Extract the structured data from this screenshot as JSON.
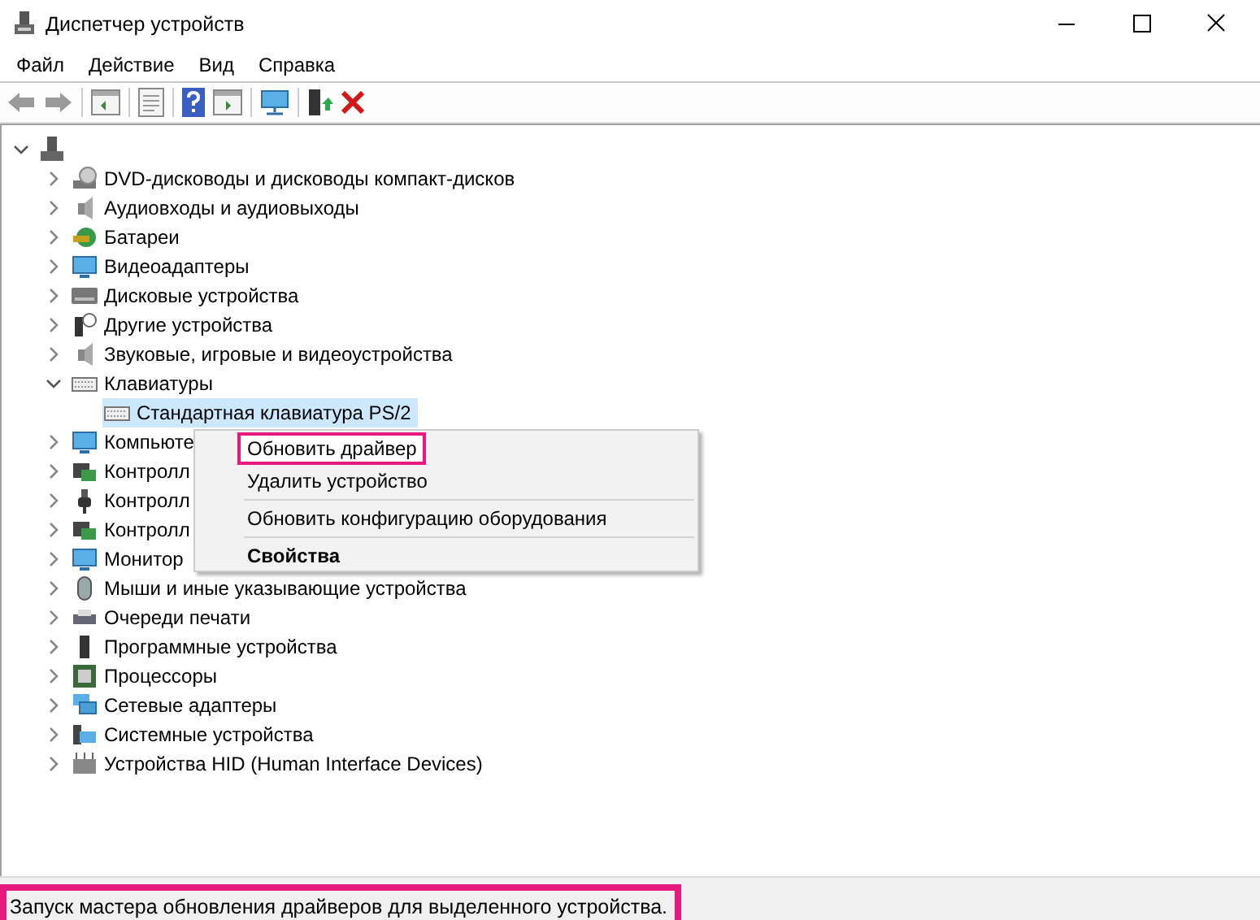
{
  "window": {
    "title": "Диспетчер устройств"
  },
  "menu_bar": [
    "Файл",
    "Действие",
    "Вид",
    "Справка"
  ],
  "tree": {
    "expanded": true,
    "selected": false,
    "children": [
      {
        "label": "DVD-дисководы и дисководы компакт-дисков",
        "expanded": false,
        "selected": false
      },
      {
        "label": "Аудиовходы и аудиовыходы",
        "expanded": false,
        "selected": false
      },
      {
        "label": "Батареи",
        "expanded": false,
        "selected": false
      },
      {
        "label": "Видеоадаптеры",
        "expanded": false,
        "selected": false
      },
      {
        "label": "Дисковые устройства",
        "expanded": false,
        "selected": false
      },
      {
        "label": "Другие устройства",
        "expanded": false,
        "selected": false
      },
      {
        "label": "Звуковые, игровые и видеоустройства",
        "expanded": false,
        "selected": false
      },
      {
        "label": "Клавиатуры",
        "expanded": true,
        "selected": false,
        "children": [
          {
            "label": "Стандартная клавиатура PS/2",
            "selected": true
          }
        ]
      },
      {
        "label": "Компьюте",
        "expanded": false,
        "selected": false
      },
      {
        "label": "Контролл",
        "expanded": false,
        "selected": false
      },
      {
        "label": "Контролл",
        "expanded": false,
        "selected": false
      },
      {
        "label": "Контролл",
        "expanded": false,
        "selected": false
      },
      {
        "label": "Монитор",
        "expanded": false,
        "selected": false
      },
      {
        "label": "Мыши и иные указывающие устройства",
        "expanded": false,
        "selected": false
      },
      {
        "label": "Очереди печати",
        "expanded": false,
        "selected": false
      },
      {
        "label": "Программные устройства",
        "expanded": false,
        "selected": false
      },
      {
        "label": "Процессоры",
        "expanded": false,
        "selected": false
      },
      {
        "label": "Сетевые адаптеры",
        "expanded": false,
        "selected": false
      },
      {
        "label": "Системные устройства",
        "expanded": false,
        "selected": false
      },
      {
        "label": "Устройства HID (Human Interface Devices)",
        "expanded": false,
        "selected": false
      }
    ]
  },
  "context_menu": {
    "items": [
      {
        "kind": "item",
        "label": "Обновить драйвер",
        "bold": false,
        "highlighted": true
      },
      {
        "kind": "item",
        "label": "Удалить устройство",
        "bold": false,
        "highlighted": false
      },
      {
        "kind": "separator"
      },
      {
        "kind": "item",
        "label": "Обновить конфигурацию оборудования",
        "bold": false,
        "highlighted": false
      },
      {
        "kind": "separator"
      },
      {
        "kind": "item",
        "label": "Свойства",
        "bold": true,
        "highlighted": false
      }
    ]
  },
  "status_bar": {
    "text": "Запуск мастера обновления драйверов для выделенного устройства.",
    "highlighted": true
  }
}
